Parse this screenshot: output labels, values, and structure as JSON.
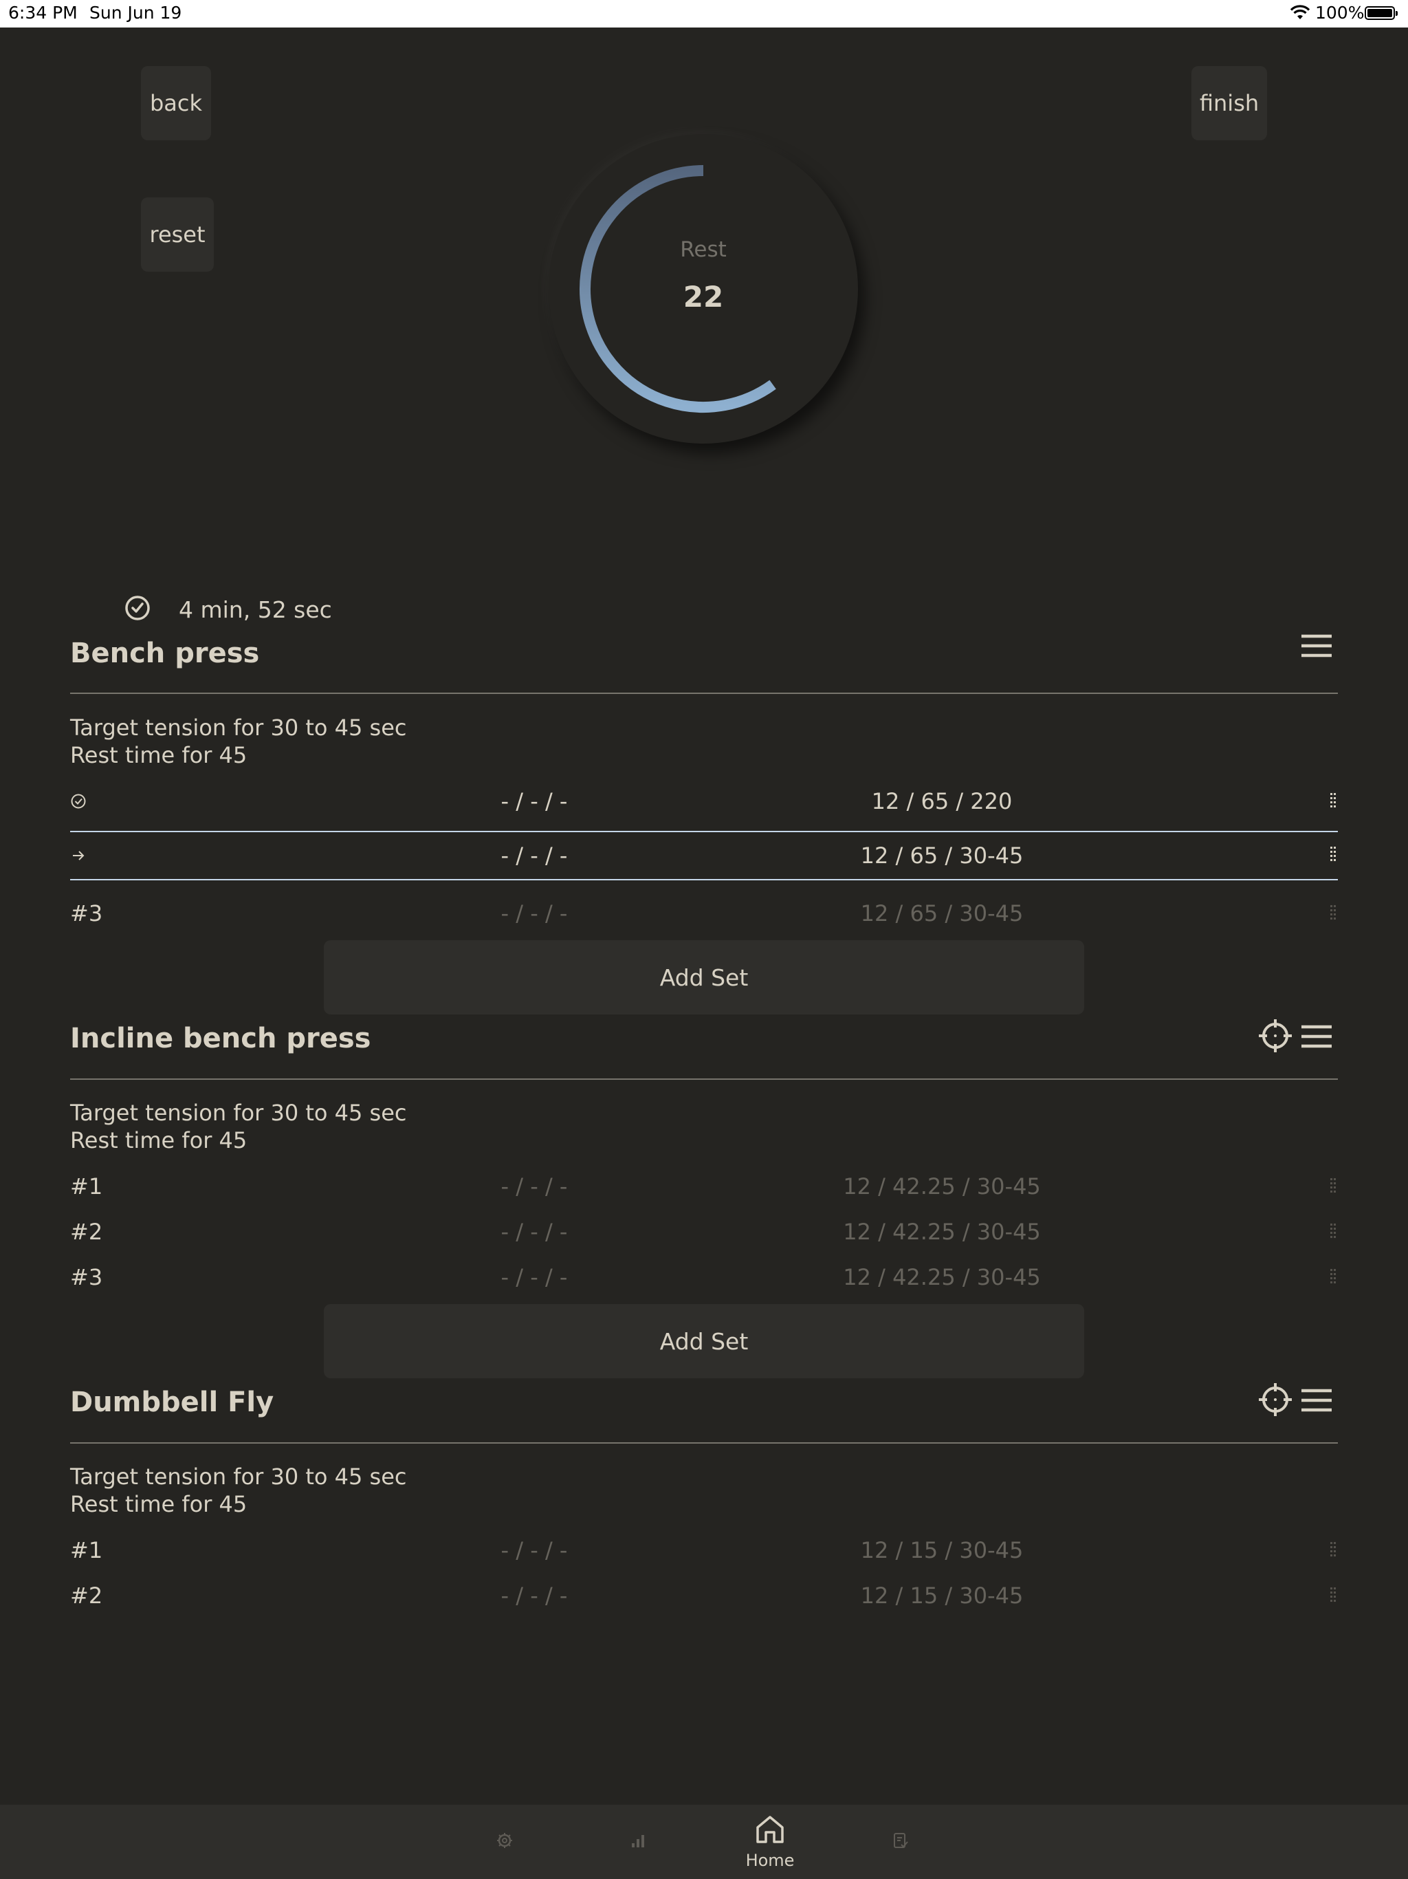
{
  "status_bar": {
    "time": "6:34 PM",
    "date": "Sun Jun 19",
    "battery_percent": "100%"
  },
  "controls": {
    "back_label": "back",
    "finish_label": "finish",
    "reset_label": "reset"
  },
  "timer": {
    "label": "Rest",
    "value": "22",
    "progress": 0.6,
    "ring_color_start": "#8eb0d0",
    "ring_color_end": "#56677f"
  },
  "session": {
    "elapsed": "4 min, 52 sec"
  },
  "exercises": [
    {
      "name": "Bench press",
      "tension": "Target tension for 30 to 45 sec",
      "rest": "Rest time for 45",
      "sets": [
        {
          "marker": "done",
          "actual": "- / - / -",
          "target": "12 / 65 / 220"
        },
        {
          "marker": "current",
          "actual": "- / - / -",
          "target": "12 / 65 / 30-45"
        },
        {
          "marker": "#3",
          "actual": "- / - / -",
          "target": "12 / 65 / 30-45"
        }
      ],
      "add_set_label": "Add Set"
    },
    {
      "name": "Incline bench press",
      "tension": "Target tension for 30 to 45 sec",
      "rest": "Rest time for 45",
      "sets": [
        {
          "marker": "#1",
          "actual": "- / - / -",
          "target": "12 / 42.25 / 30-45"
        },
        {
          "marker": "#2",
          "actual": "- / - / -",
          "target": "12 / 42.25 / 30-45"
        },
        {
          "marker": "#3",
          "actual": "- / - / -",
          "target": "12 / 42.25 / 30-45"
        }
      ],
      "add_set_label": "Add Set"
    },
    {
      "name": "Dumbbell Fly",
      "tension": "Target tension for 30 to 45 sec",
      "rest": "Rest time for 45",
      "sets": [
        {
          "marker": "#1",
          "actual": "- / - / -",
          "target": "12 / 15 / 30-45"
        },
        {
          "marker": "#2",
          "actual": "- / - / -",
          "target": "12 / 15 / 30-45"
        }
      ]
    }
  ],
  "tab_bar": {
    "home_label": "Home",
    "tabs": [
      "settings-icon",
      "chart-icon",
      "home-icon",
      "log-icon"
    ]
  }
}
